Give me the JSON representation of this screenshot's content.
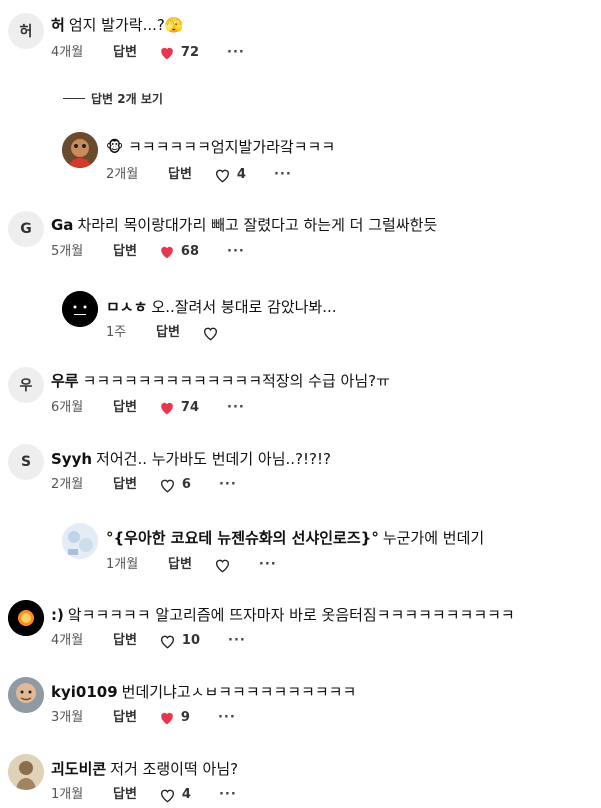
{
  "comments": [
    {
      "id": "c1",
      "avatar_text": "허",
      "author": "허",
      "text": "엄지 발가락...?🫣",
      "time": "4개월",
      "reply": "답변",
      "likes": "72",
      "liked": true,
      "more": "···"
    },
    {
      "id": "c2",
      "avatar_text": "",
      "author": "",
      "text": "🐵 ㅋㅋㅋㅋㅋㅋ엄지발가라갘ㅋㅋㅋ",
      "time": "2개월",
      "reply": "답변",
      "likes": "4",
      "liked": false,
      "more": "···"
    },
    {
      "id": "c3",
      "avatar_text": "G",
      "author": "Ga",
      "text": "차라리 목이랑대가리 빼고 잘렸다고 하는게 더 그럴싸한듯",
      "time": "5개월",
      "reply": "답변",
      "likes": "68",
      "liked": true,
      "more": "···"
    },
    {
      "id": "c4",
      "avatar_text": "",
      "author": "ㅁㅅㅎ",
      "text": "오..잘려서 붕대로 감았나봐...",
      "time": "1주",
      "reply": "답변",
      "likes": "",
      "liked": false,
      "more": ""
    },
    {
      "id": "c5",
      "avatar_text": "우",
      "author": "우루",
      "text": "ㅋㅋㅋㅋㅋㅋㅋㅋㅋㅋㅋㅋㅋ적장의 수급 아님?ㅠ",
      "time": "6개월",
      "reply": "답변",
      "likes": "74",
      "liked": true,
      "more": "···"
    },
    {
      "id": "c6",
      "avatar_text": "S",
      "author": "Syyh",
      "text": "저어건.. 누가바도 번데기 아님..?!?!?",
      "time": "2개월",
      "reply": "답변",
      "likes": "6",
      "liked": false,
      "more": "···"
    },
    {
      "id": "c7",
      "avatar_text": "",
      "author": "°{우아한 코요테 뉴젠슈화의 선샤인로즈}°",
      "text": "누군가에 번데기",
      "time": "1개월",
      "reply": "답변",
      "likes": "",
      "liked": false,
      "more": "···"
    },
    {
      "id": "c8",
      "avatar_text": "",
      "author": ":)",
      "text": "앜ㅋㅋㅋㅋㅋ 알고리즘에 뜨자마자 바로 옷음터짐ㅋㅋㅋㅋㅋㅋㅋㅋㅋㅋ",
      "time": "4개월",
      "reply": "답변",
      "likes": "10",
      "liked": false,
      "more": "···"
    },
    {
      "id": "c9",
      "avatar_text": "",
      "author": "kyi0109",
      "text": "번데기냐고ㅅㅂㅋㅋㅋㅋㅋㅋㅋㅋㅋㅋ",
      "time": "3개월",
      "reply": "답변",
      "likes": "9",
      "liked": true,
      "more": "···"
    },
    {
      "id": "c10",
      "avatar_text": "",
      "author": "괴도비콘",
      "text": "저거 조랭이떡 아님?",
      "time": "1개월",
      "reply": "답변",
      "likes": "4",
      "liked": false,
      "more": "···"
    }
  ],
  "view_replies_label": "답변 2개 보기",
  "colors": {
    "heart": "#e8364e",
    "avatar_bg": "#eeeeee",
    "text": "#111111",
    "muted": "#555555"
  }
}
